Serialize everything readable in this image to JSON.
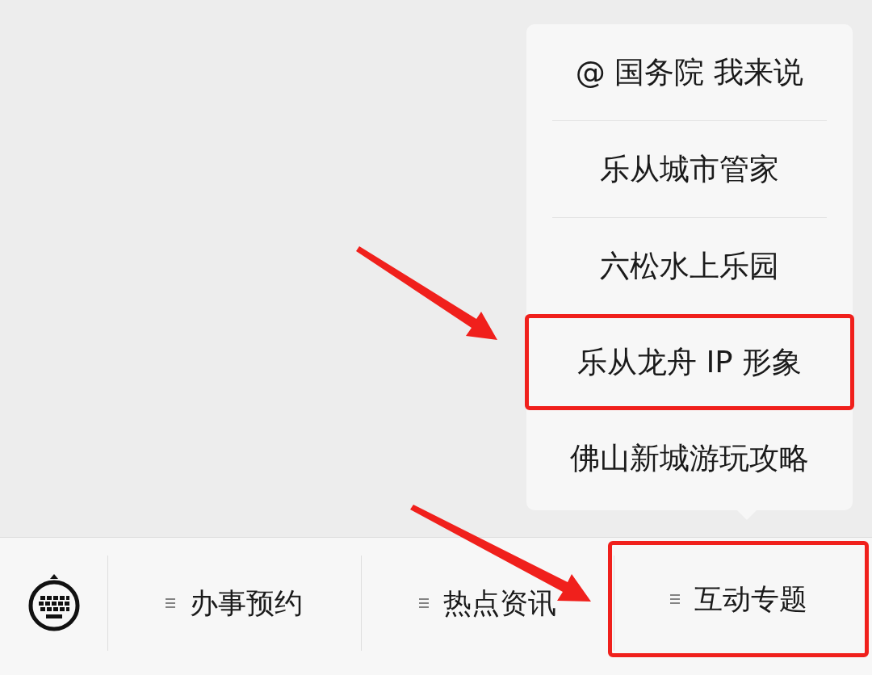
{
  "menu_popup": {
    "items": [
      {
        "label": "@ 国务院 我来说",
        "divider": true,
        "highlighted": false
      },
      {
        "label": "乐从城市管家",
        "divider": true,
        "highlighted": false
      },
      {
        "label": "六松水上乐园",
        "divider": false,
        "highlighted": false
      },
      {
        "label": "乐从龙舟 IP 形象",
        "divider": false,
        "highlighted": true
      },
      {
        "label": "佛山新城游玩攻略",
        "divider": false,
        "highlighted": false
      }
    ]
  },
  "bottom_menu": {
    "tabs": [
      {
        "label": "办事预约",
        "highlighted": false
      },
      {
        "label": "热点资讯",
        "highlighted": false
      },
      {
        "label": "互动专题",
        "highlighted": true
      }
    ]
  }
}
